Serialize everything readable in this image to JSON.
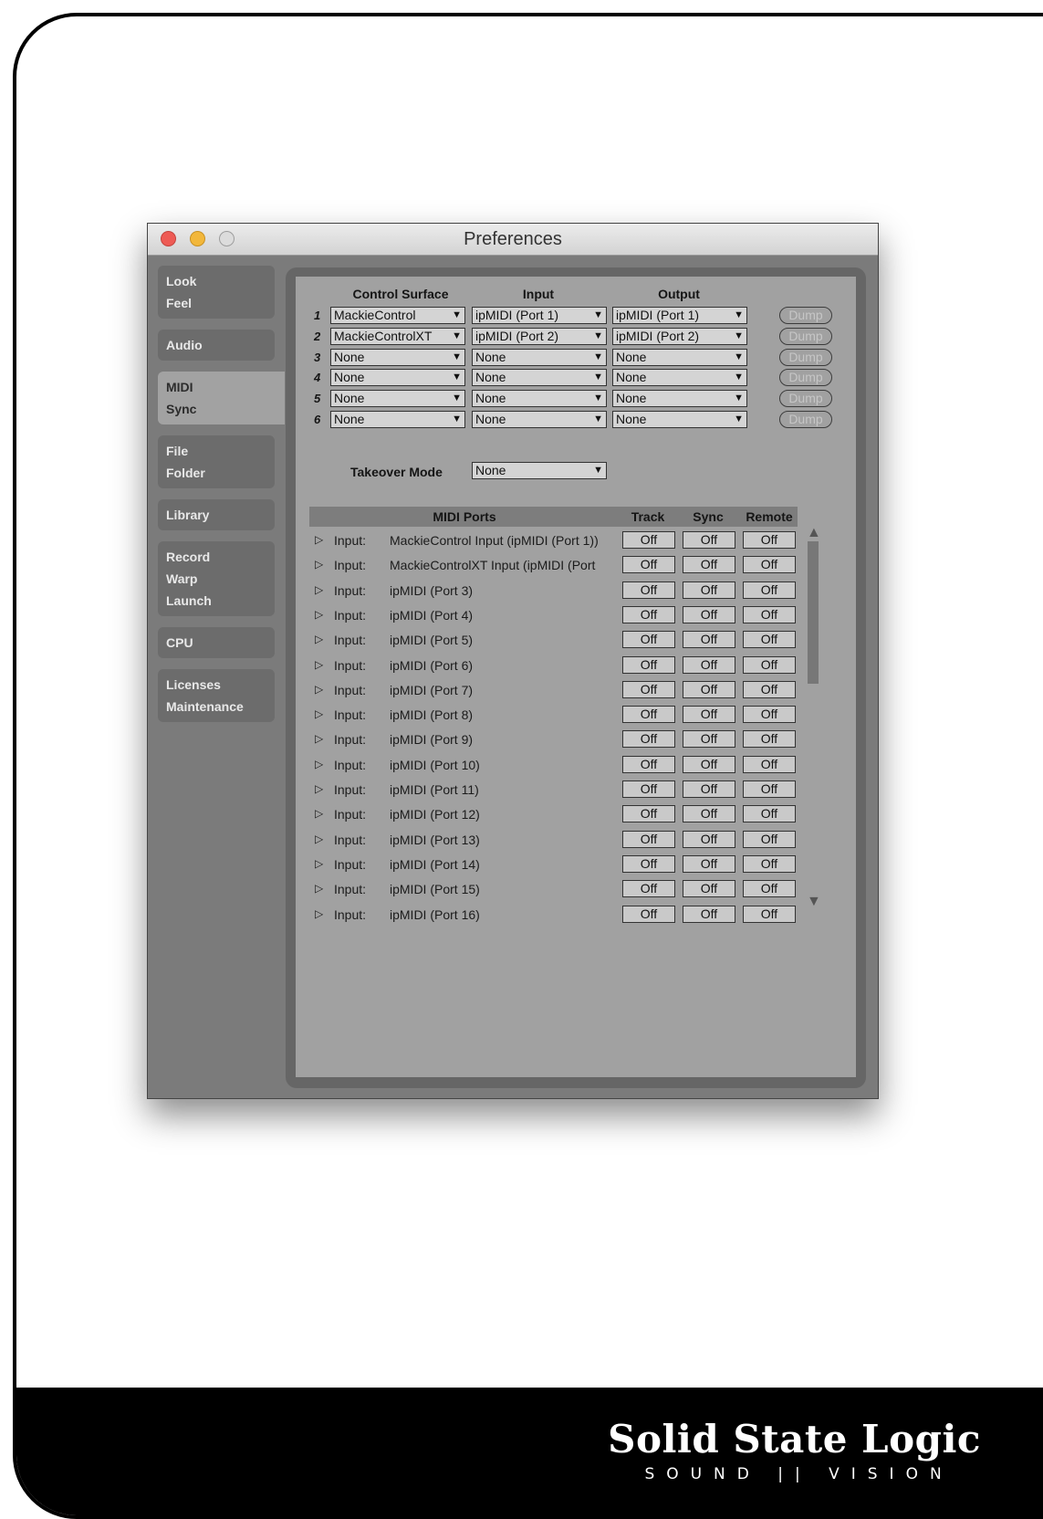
{
  "window": {
    "title": "Preferences"
  },
  "sidebar": {
    "groups": [
      {
        "items": [
          "Look",
          "Feel"
        ]
      },
      {
        "items": [
          "Audio"
        ]
      },
      {
        "items": [
          "MIDI",
          "Sync"
        ],
        "active": true
      },
      {
        "items": [
          "File",
          "Folder"
        ]
      },
      {
        "items": [
          "Library"
        ]
      },
      {
        "items": [
          "Record",
          "Warp",
          "Launch"
        ]
      },
      {
        "items": [
          "CPU"
        ]
      },
      {
        "items": [
          "Licenses",
          "Maintenance"
        ]
      }
    ]
  },
  "control_surfaces": {
    "headers": {
      "surface": "Control Surface",
      "input": "Input",
      "output": "Output"
    },
    "dump_label": "Dump",
    "rows": [
      {
        "num": "1",
        "surface": "MackieControl",
        "input": "ipMIDI (Port 1)",
        "output": "ipMIDI (Port 1)"
      },
      {
        "num": "2",
        "surface": "MackieControlXT",
        "input": "ipMIDI (Port 2)",
        "output": "ipMIDI (Port 2)"
      },
      {
        "num": "3",
        "surface": "None",
        "input": "None",
        "output": "None"
      },
      {
        "num": "4",
        "surface": "None",
        "input": "None",
        "output": "None"
      },
      {
        "num": "5",
        "surface": "None",
        "input": "None",
        "output": "None"
      },
      {
        "num": "6",
        "surface": "None",
        "input": "None",
        "output": "None"
      }
    ]
  },
  "takeover": {
    "label": "Takeover Mode",
    "value": "None"
  },
  "midi_ports": {
    "headers": {
      "ports": "MIDI Ports",
      "track": "Track",
      "sync": "Sync",
      "remote": "Remote"
    },
    "rows": [
      {
        "dir": "Input:",
        "name": "MackieControl Input (ipMIDI (Port 1))",
        "track": "Off",
        "sync": "Off",
        "remote": "Off"
      },
      {
        "dir": "Input:",
        "name": "MackieControlXT Input (ipMIDI (Port",
        "track": "Off",
        "sync": "Off",
        "remote": "Off"
      },
      {
        "dir": "Input:",
        "name": "ipMIDI (Port 3)",
        "track": "Off",
        "sync": "Off",
        "remote": "Off"
      },
      {
        "dir": "Input:",
        "name": "ipMIDI (Port 4)",
        "track": "Off",
        "sync": "Off",
        "remote": "Off"
      },
      {
        "dir": "Input:",
        "name": "ipMIDI (Port 5)",
        "track": "Off",
        "sync": "Off",
        "remote": "Off"
      },
      {
        "dir": "Input:",
        "name": "ipMIDI (Port 6)",
        "track": "Off",
        "sync": "Off",
        "remote": "Off"
      },
      {
        "dir": "Input:",
        "name": "ipMIDI (Port 7)",
        "track": "Off",
        "sync": "Off",
        "remote": "Off"
      },
      {
        "dir": "Input:",
        "name": "ipMIDI (Port 8)",
        "track": "Off",
        "sync": "Off",
        "remote": "Off"
      },
      {
        "dir": "Input:",
        "name": "ipMIDI (Port 9)",
        "track": "Off",
        "sync": "Off",
        "remote": "Off"
      },
      {
        "dir": "Input:",
        "name": "ipMIDI (Port 10)",
        "track": "Off",
        "sync": "Off",
        "remote": "Off"
      },
      {
        "dir": "Input:",
        "name": "ipMIDI (Port 11)",
        "track": "Off",
        "sync": "Off",
        "remote": "Off"
      },
      {
        "dir": "Input:",
        "name": "ipMIDI (Port 12)",
        "track": "Off",
        "sync": "Off",
        "remote": "Off"
      },
      {
        "dir": "Input:",
        "name": "ipMIDI (Port 13)",
        "track": "Off",
        "sync": "Off",
        "remote": "Off"
      },
      {
        "dir": "Input:",
        "name": "ipMIDI (Port 14)",
        "track": "Off",
        "sync": "Off",
        "remote": "Off"
      },
      {
        "dir": "Input:",
        "name": "ipMIDI (Port 15)",
        "track": "Off",
        "sync": "Off",
        "remote": "Off"
      },
      {
        "dir": "Input:",
        "name": "ipMIDI (Port 16)",
        "track": "Off",
        "sync": "Off",
        "remote": "Off"
      }
    ]
  },
  "footer": {
    "brand": "Solid State Logic",
    "tagline": "SOUND || VISION"
  }
}
